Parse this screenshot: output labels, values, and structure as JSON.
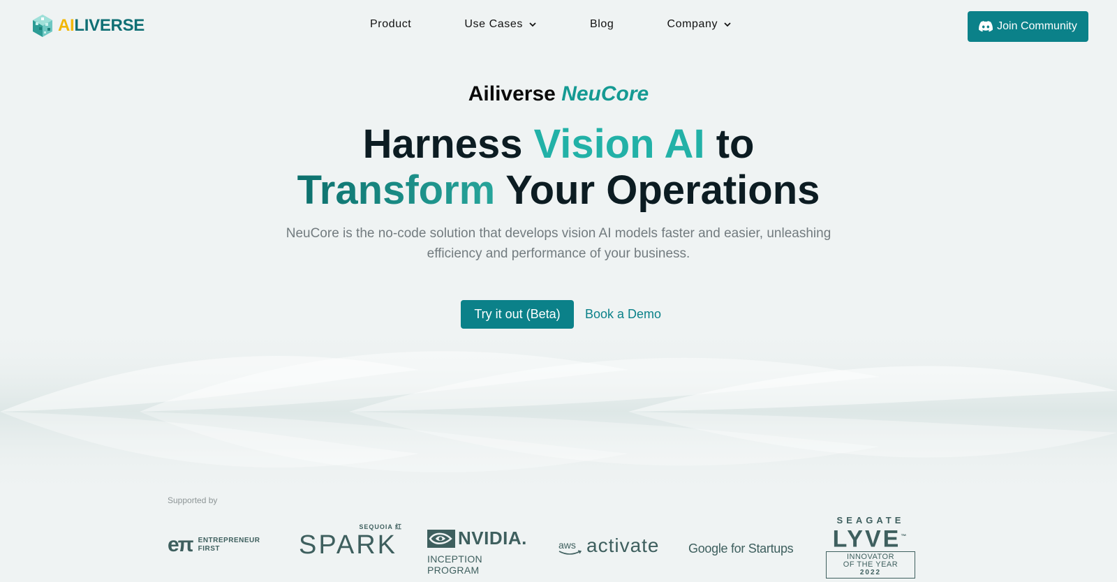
{
  "brand": {
    "logo_ai": "AI",
    "logo_rest": "LIVERSE",
    "logo_colors": {
      "ai": "#f2b705",
      "rest": "#0f6f74"
    }
  },
  "nav": {
    "product": "Product",
    "use_cases": "Use Cases",
    "blog": "Blog",
    "company": "Company"
  },
  "header": {
    "join_label": "Join Community",
    "join_icon": "discord-icon"
  },
  "hero": {
    "eyebrow_prefix": "Ailiverse",
    "eyebrow_highlight": "NeuCore",
    "headline_part1": "Harness",
    "headline_highlight1": "Vision AI",
    "headline_part2": "to",
    "headline_highlight2": "Transform",
    "headline_part3": "Your Operations",
    "subtitle": "NeuCore is the no-code solution that develops vision AI models faster and easier, unleashing efficiency and performance of your business.",
    "cta_primary": "Try it out (Beta)",
    "cta_secondary": "Book a Demo"
  },
  "supporters": {
    "label": "Supported by",
    "ef": {
      "mark": "eπ",
      "line1": "ENTREPRENEUR",
      "line2": "FIRST"
    },
    "spark": {
      "top": "SEQUOIA 红",
      "word": "SPARK"
    },
    "nvidia": {
      "word": "NVIDIA.",
      "program": "INCEPTION PROGRAM"
    },
    "aws": {
      "small": "aws",
      "word": "activate"
    },
    "google": {
      "main": "Google for Startups"
    },
    "lyve": {
      "top": "SEAGATE",
      "word": "LYVE",
      "tm": "™",
      "line1": "INNOVATOR",
      "line2": "OF THE YEAR",
      "year": "2022"
    }
  },
  "colors": {
    "accent": "#0b8189",
    "background": "#eff3f3",
    "partner_logo": "#3e5f5e"
  }
}
